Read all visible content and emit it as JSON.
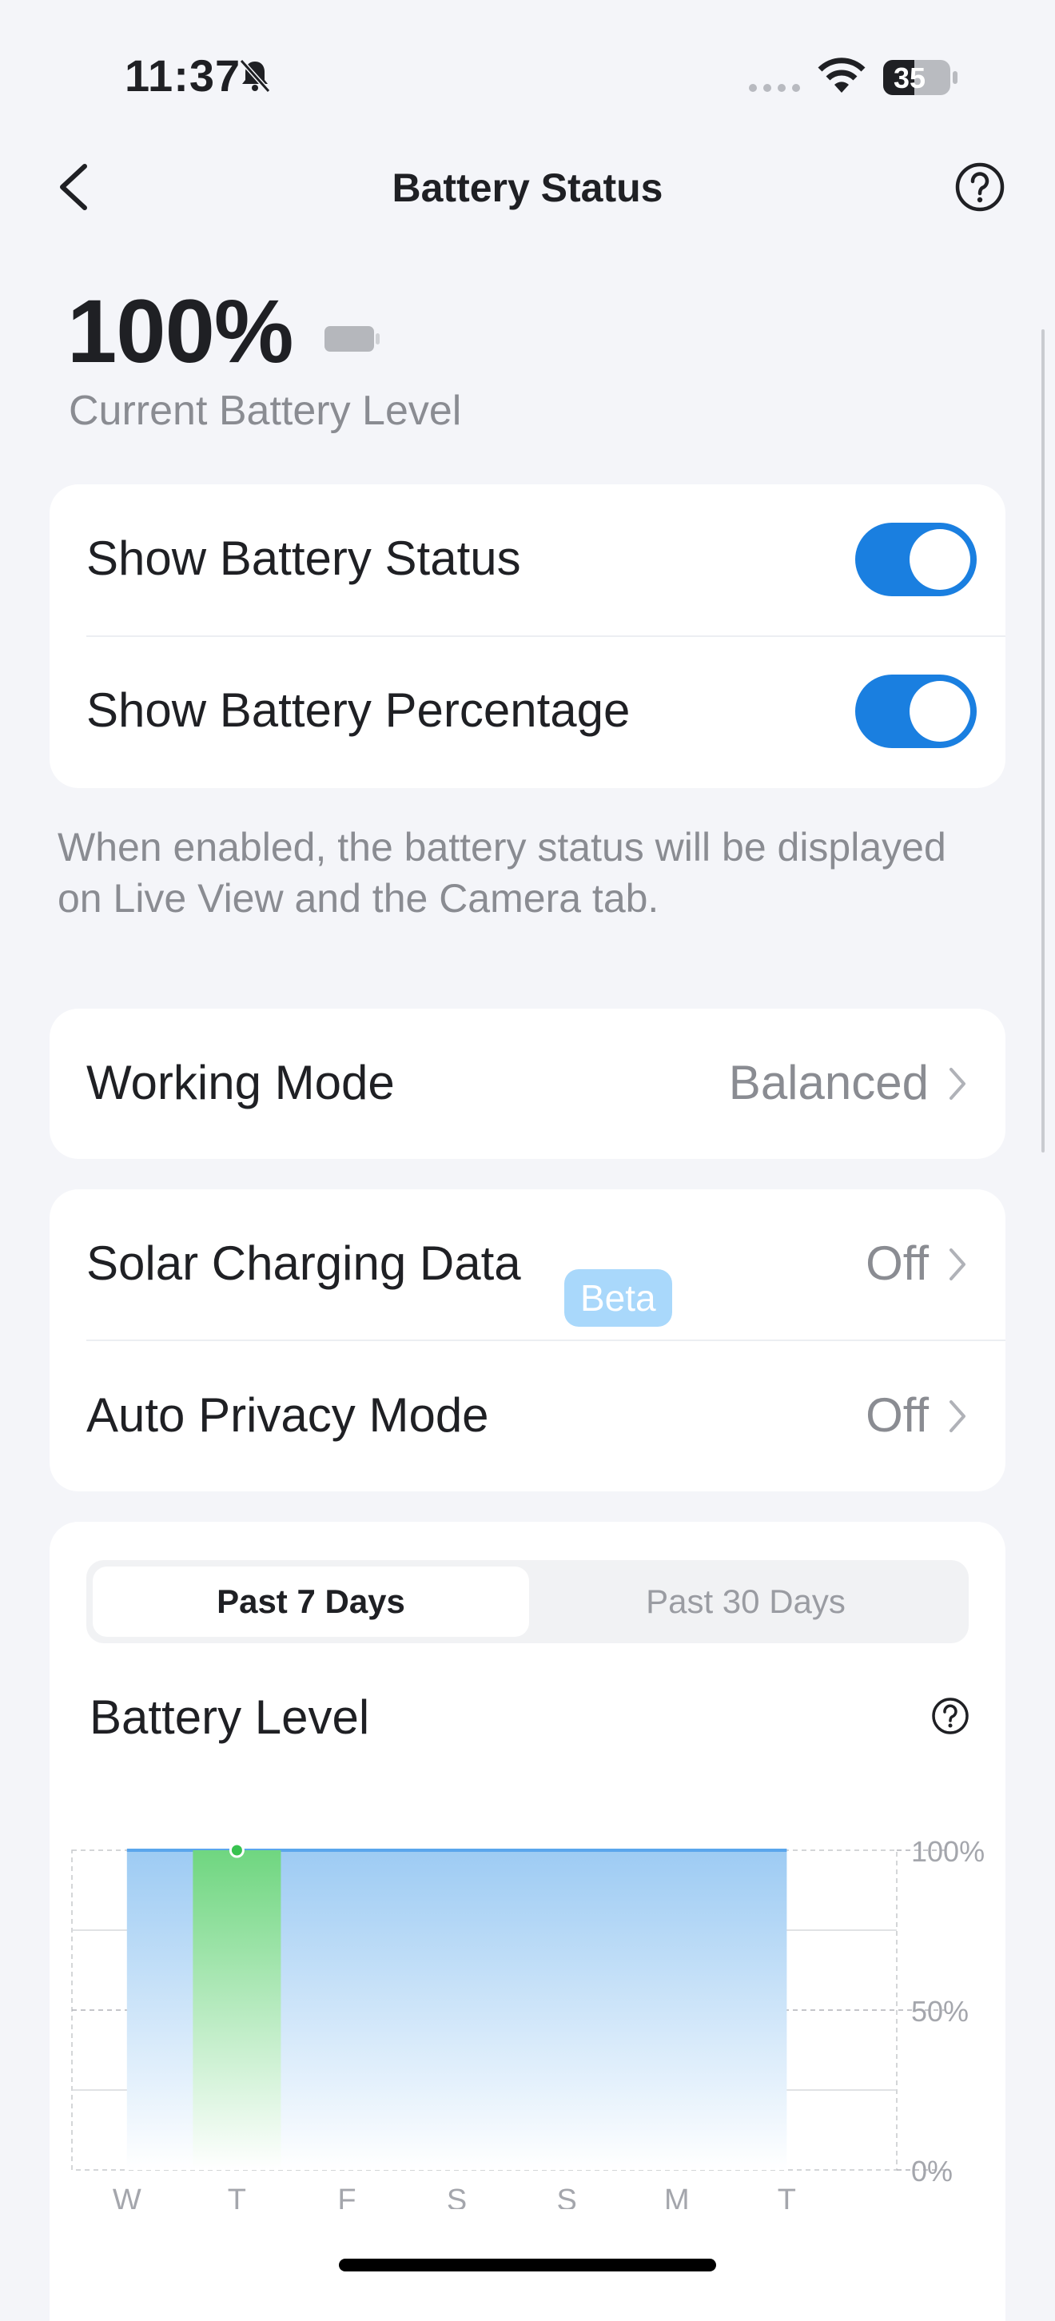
{
  "status_bar": {
    "time": "11:37",
    "battery": "35"
  },
  "nav": {
    "title": "Battery Status"
  },
  "battery": {
    "percent": "100%",
    "label": "Current Battery Level"
  },
  "display_settings": {
    "show_status_label": "Show Battery Status",
    "show_status_on": true,
    "show_percentage_label": "Show Battery Percentage",
    "show_percentage_on": true,
    "note": "When enabled, the battery status will be displayed on Live View and the Camera tab."
  },
  "working_mode": {
    "label": "Working Mode",
    "value": "Balanced"
  },
  "solar": {
    "label": "Solar Charging Data",
    "badge": "Beta",
    "value": "Off"
  },
  "privacy": {
    "label": "Auto Privacy Mode",
    "value": "Off"
  },
  "history": {
    "tabs": [
      {
        "label": "Past 7 Days",
        "active": true
      },
      {
        "label": "Past 30 Days",
        "active": false
      }
    ],
    "title": "Battery Level"
  },
  "colors": {
    "accent": "#1a7fe0",
    "fill": "#9dcbf3",
    "charging": "#6fd680"
  },
  "chart_data": {
    "type": "area",
    "title": "Battery Level",
    "categories": [
      "W",
      "T",
      "F",
      "S",
      "S",
      "M",
      "T"
    ],
    "y_ticks": [
      "100%",
      "50%",
      "0%"
    ],
    "ylim": [
      0,
      100
    ],
    "series": [
      {
        "values": [
          100,
          100,
          100,
          100,
          100,
          100,
          100
        ]
      }
    ],
    "charging_segment": {
      "from": "T",
      "value": 100
    },
    "grid": true
  }
}
